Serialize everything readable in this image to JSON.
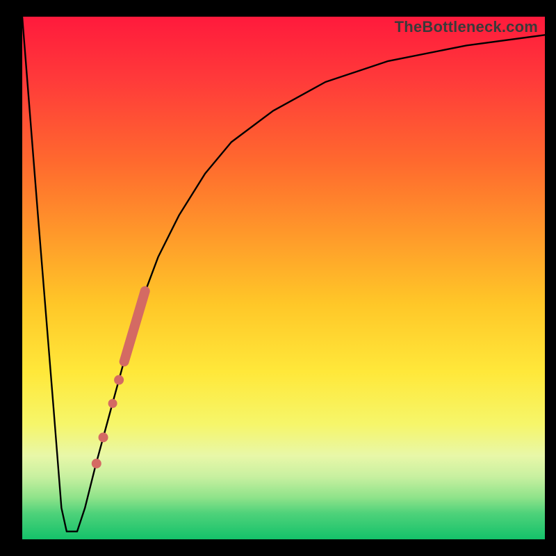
{
  "watermark": "TheBottleneck.com",
  "colors": {
    "curve_stroke": "#000000",
    "marker_fill": "#d46a63",
    "marker_stroke": "#c15a54"
  },
  "chart_data": {
    "type": "line",
    "title": "",
    "xlabel": "",
    "ylabel": "",
    "xlim": [
      0,
      100
    ],
    "ylim": [
      0,
      100
    ],
    "curve": [
      {
        "x": 0.0,
        "y": 100.0
      },
      {
        "x": 3.0,
        "y": 62.0
      },
      {
        "x": 6.0,
        "y": 25.0
      },
      {
        "x": 7.5,
        "y": 6.0
      },
      {
        "x": 8.5,
        "y": 1.5
      },
      {
        "x": 10.5,
        "y": 1.5
      },
      {
        "x": 12.0,
        "y": 6.0
      },
      {
        "x": 14.0,
        "y": 14.0
      },
      {
        "x": 17.0,
        "y": 25.0
      },
      {
        "x": 20.0,
        "y": 36.0
      },
      {
        "x": 23.0,
        "y": 46.0
      },
      {
        "x": 26.0,
        "y": 54.0
      },
      {
        "x": 30.0,
        "y": 62.0
      },
      {
        "x": 35.0,
        "y": 70.0
      },
      {
        "x": 40.0,
        "y": 76.0
      },
      {
        "x": 48.0,
        "y": 82.0
      },
      {
        "x": 58.0,
        "y": 87.5
      },
      {
        "x": 70.0,
        "y": 91.5
      },
      {
        "x": 85.0,
        "y": 94.5
      },
      {
        "x": 100.0,
        "y": 96.5
      }
    ],
    "markers_segment": {
      "start": {
        "x": 19.5,
        "y": 34.0
      },
      "end": {
        "x": 23.5,
        "y": 47.5
      },
      "width": 14
    },
    "markers_dots": [
      {
        "x": 18.5,
        "y": 30.5,
        "r": 7
      },
      {
        "x": 17.3,
        "y": 26.0,
        "r": 6.5
      },
      {
        "x": 15.5,
        "y": 19.5,
        "r": 7
      },
      {
        "x": 14.2,
        "y": 14.5,
        "r": 7
      }
    ]
  }
}
